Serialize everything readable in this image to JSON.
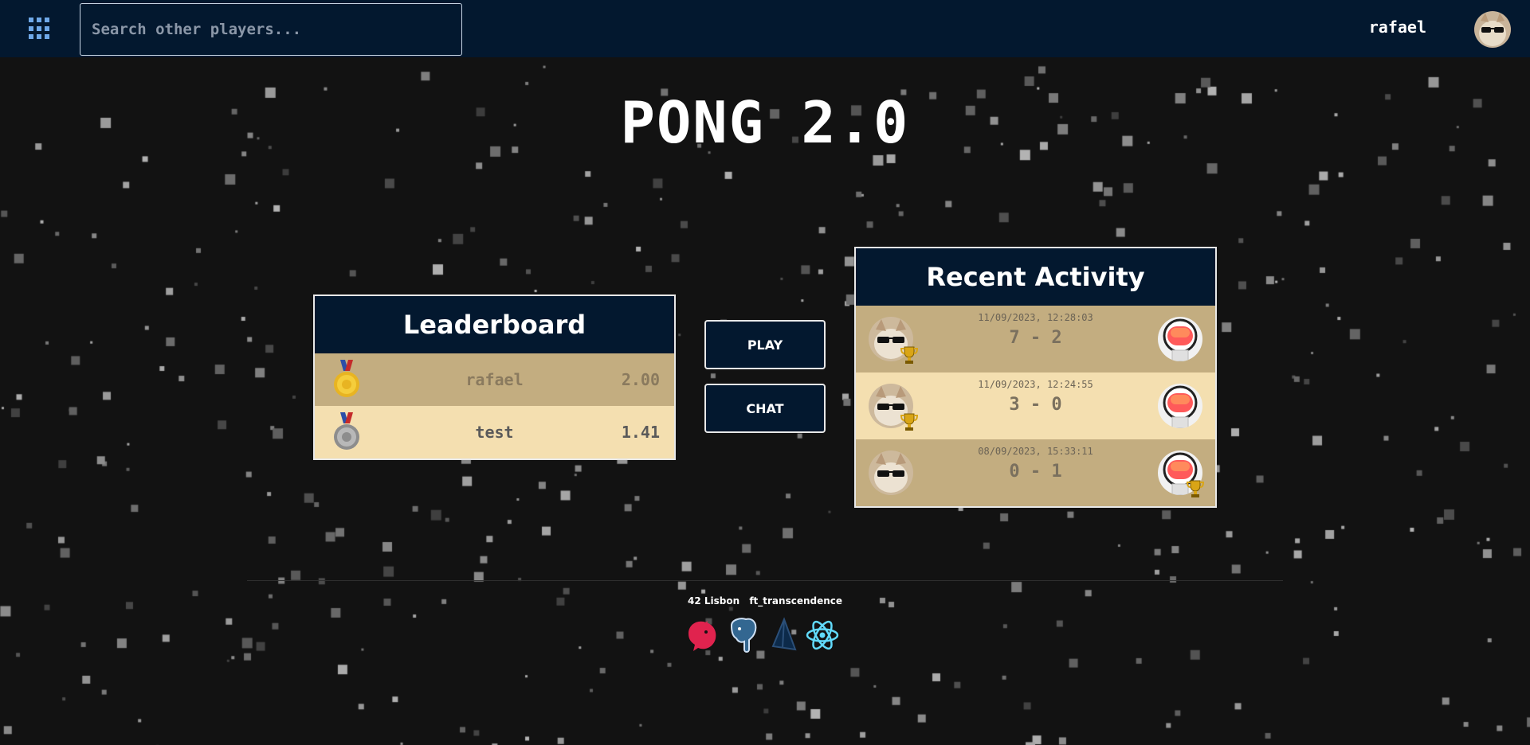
{
  "header": {
    "search_placeholder": "Search other players...",
    "username": "rafael"
  },
  "title": "PONG 2.0",
  "leaderboard": {
    "title": "Leaderboard",
    "rows": [
      {
        "medal": "gold-medal-icon",
        "name": "rafael",
        "score": "2.00"
      },
      {
        "medal": "silver-medal-icon",
        "name": "test",
        "score": "1.41"
      }
    ]
  },
  "actions": {
    "play_label": "PLAY",
    "chat_label": "CHAT"
  },
  "recent_activity": {
    "title": "Recent Activity",
    "matches": [
      {
        "date": "11/09/2023, 12:28:03",
        "score": "7 - 2",
        "winner": "left"
      },
      {
        "date": "11/09/2023, 12:24:55",
        "score": "3 - 0",
        "winner": "left"
      },
      {
        "date": "08/09/2023, 15:33:11",
        "score": "0 - 1",
        "winner": "right"
      }
    ]
  },
  "footer": {
    "school": "42 Lisbon",
    "project": "ft_transcendence",
    "tech_icons": [
      "nestjs-icon",
      "postgresql-icon",
      "prisma-icon",
      "react-icon"
    ]
  },
  "colors": {
    "navy": "#03182f",
    "row_dark": "#c3ad80",
    "row_light": "#f4dfb0",
    "background": "#121212"
  }
}
